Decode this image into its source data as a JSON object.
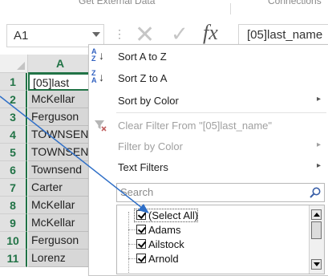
{
  "ribbon": {
    "left_group": "Get External Data",
    "right_group": "Connections"
  },
  "formula_bar": {
    "name_box": "A1",
    "more_icon": "more-dots-icon",
    "cancel_icon": "cancel-x-icon",
    "enter_icon": "enter-check-icon",
    "fx_label": "fx",
    "formula_value": "[05]last_name"
  },
  "grid": {
    "column_header": "A",
    "rows": [
      {
        "num": "1",
        "value": "[05]last"
      },
      {
        "num": "2",
        "value": "McKellar"
      },
      {
        "num": "3",
        "value": "Ferguson"
      },
      {
        "num": "4",
        "value": "TOWNSEN"
      },
      {
        "num": "5",
        "value": "TOWNSEN"
      },
      {
        "num": "6",
        "value": "Townsend"
      },
      {
        "num": "7",
        "value": "Carter"
      },
      {
        "num": "8",
        "value": "McKellar"
      },
      {
        "num": "9",
        "value": "McKellar"
      },
      {
        "num": "10",
        "value": "Ferguson"
      },
      {
        "num": "11",
        "value": "Lorenz"
      }
    ]
  },
  "filter_menu": {
    "sort_az": "Sort A to Z",
    "sort_za": "Sort Z to A",
    "sort_by_color": "Sort by Color",
    "clear_filter": "Clear Filter From \"[05]last_name\"",
    "filter_by_color": "Filter by Color",
    "text_filters": "Text Filters",
    "submenu_arrow": "▸",
    "search_placeholder": "Search",
    "list_items": [
      "(Select All)",
      "Adams",
      "Ailstock",
      "Arnold"
    ]
  },
  "colors": {
    "excel_green": "#217346",
    "selected_fill": "#d7d7d7",
    "pointer_blue": "#2f6fc7"
  }
}
